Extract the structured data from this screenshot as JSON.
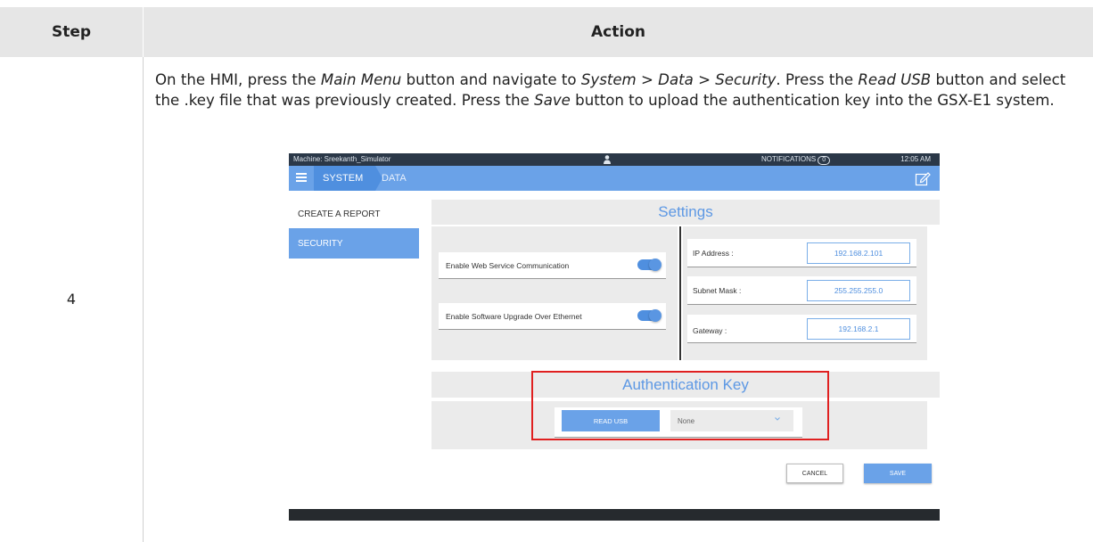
{
  "table": {
    "header_step": "Step",
    "header_action": "Action",
    "step_number": "4",
    "action": {
      "p1": "On the HMI, press the ",
      "main_menu": "Main Menu",
      "p2": " button and navigate to ",
      "nav_path": "System > Data > Security",
      "p3": ". Press the ",
      "read_usb": "Read USB",
      "p4": " button and select the .key file that was previously created. Press the ",
      "save": "Save",
      "p5": " button to upload the authentication key into the GSX-E1 system."
    }
  },
  "hmi": {
    "status_bar": {
      "machine": "Machine: Sreekanth_Simulator",
      "user_icon": "user-icon",
      "notifications_label": "NOTIFICATIONS",
      "notifications_count": "0",
      "time": "12:05 AM"
    },
    "nav": {
      "menu_icon": "hamburger-menu-icon",
      "crumb_system": "SYSTEM",
      "crumb_data": "DATA",
      "edit_icon": "edit-icon"
    },
    "sidebar": {
      "items": [
        "CREATE A REPORT",
        "SECURITY"
      ],
      "active": "SECURITY"
    },
    "settings": {
      "title": "Settings",
      "toggles": [
        {
          "label": "Enable Web Service Communication",
          "on": true
        },
        {
          "label": "Enable Software Upgrade Over Ethernet",
          "on": true
        }
      ],
      "network": [
        {
          "label": "IP Address :",
          "value": "192.168.2.101"
        },
        {
          "label": "Subnet Mask :",
          "value": "255.255.255.0"
        },
        {
          "label": "Gateway :",
          "value": "192.168.2.1"
        }
      ]
    },
    "auth": {
      "title": "Authentication Key",
      "read_usb_label": "READ USB",
      "select_value": "None",
      "chevron_icon": "chevron-down-icon"
    },
    "buttons": {
      "cancel": "CANCEL",
      "save": "SAVE"
    },
    "colors": {
      "accent": "#6aa2e8",
      "status_bar": "#2b3848",
      "highlight": "#e02020",
      "panel": "#ebebeb"
    }
  }
}
